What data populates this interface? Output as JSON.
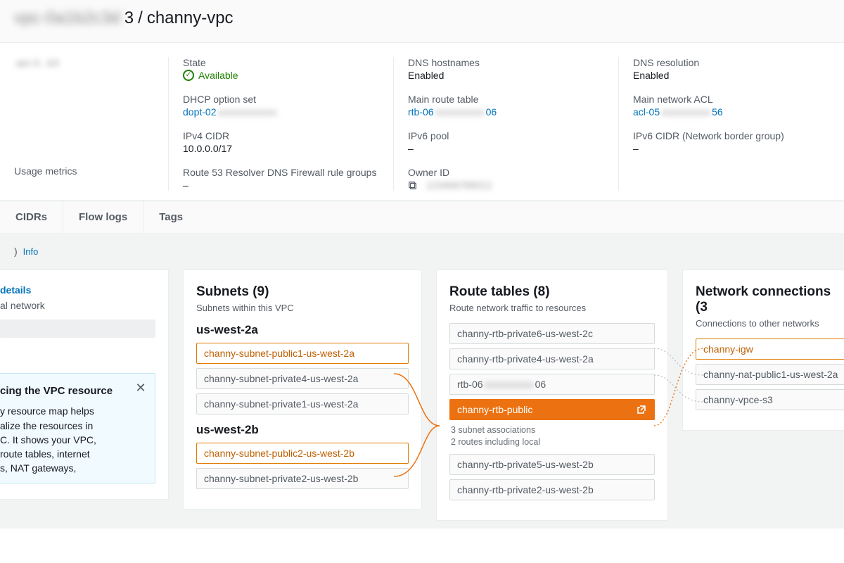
{
  "breadcrumb": {
    "prefix_blur": "vpc-0a1b2c3d",
    "sep": "/",
    "vpc_id_tail": "3",
    "vpc_name": "channy-vpc"
  },
  "details": {
    "col1": {
      "id_blur": "vpc-0...b3",
      "usage_metrics_label": "Usage metrics"
    },
    "col2": {
      "state_label": "State",
      "state_value": "Available",
      "dhcp_label": "DHCP option set",
      "dhcp_prefix": "dopt-02",
      "dhcp_blur": "xxxxxxxxxxxx",
      "ipv4_label": "IPv4 CIDR",
      "ipv4_value": "10.0.0.0/17",
      "r53_label": "Route 53 Resolver DNS Firewall rule groups",
      "dash": "–"
    },
    "col3": {
      "dns_host_label": "DNS hostnames",
      "dns_host_value": "Enabled",
      "main_rt_label": "Main route table",
      "main_rt_prefix": "rtb-06",
      "main_rt_blur": "xxxxxxxxxx",
      "main_rt_suffix": "06",
      "ipv6_pool_label": "IPv6 pool",
      "owner_label": "Owner ID",
      "owner_blur": "123456789012",
      "dash": "–"
    },
    "col4": {
      "dns_res_label": "DNS resolution",
      "dns_res_value": "Enabled",
      "acl_label": "Main network ACL",
      "acl_prefix": "acl-05",
      "acl_blur": "xxxxxxxxxx",
      "acl_suffix": "56",
      "ipv6_cidr_label": "IPv6 CIDR (Network border group)",
      "dash": "–"
    }
  },
  "tabs": {
    "cidrs": "CIDRs",
    "flowlogs": "Flow logs",
    "tags": "Tags"
  },
  "info_link": "Info",
  "vpc_card": {
    "details_link": "details",
    "sub": "al network",
    "pop_title": "cing the VPC resource",
    "pop_body": "y resource map helps\nalize the resources in\nC. It shows your VPC,\n route tables, internet\ns, NAT gateways,"
  },
  "subnets": {
    "title": "Subnets (9)",
    "sub": "Subnets within this VPC",
    "az1": "us-west-2a",
    "az1_items": [
      {
        "label": "channy-subnet-public1-us-west-2a",
        "hl": true
      },
      {
        "label": "channy-subnet-private4-us-west-2a",
        "hl": false
      },
      {
        "label": "channy-subnet-private1-us-west-2a",
        "hl": false
      }
    ],
    "az2": "us-west-2b",
    "az2_items": [
      {
        "label": "channy-subnet-public2-us-west-2b",
        "hl": true
      },
      {
        "label": "channy-subnet-private2-us-west-2b",
        "hl": false
      }
    ]
  },
  "route_tables": {
    "title": "Route tables (8)",
    "sub": "Route network traffic to resources",
    "items": [
      {
        "label": "channy-rtb-private6-us-west-2c",
        "state": ""
      },
      {
        "label": "channy-rtb-private4-us-west-2a",
        "state": ""
      },
      {
        "label": "rtb-06xxxxxxxxxx06",
        "state": "blur"
      },
      {
        "label": "channy-rtb-public",
        "state": "selected"
      },
      {
        "label": "channy-rtb-private5-us-west-2b",
        "state": ""
      },
      {
        "label": "channy-rtb-private2-us-west-2b",
        "state": ""
      }
    ],
    "selected_meta1": "3 subnet associations",
    "selected_meta2": "2 routes including local"
  },
  "net_conn": {
    "title": "Network connections (3",
    "sub": "Connections to other networks",
    "items": [
      {
        "label": "channy-igw",
        "hl": true
      },
      {
        "label": "channy-nat-public1-us-west-2a",
        "hl": false
      },
      {
        "label": "channy-vpce-s3",
        "hl": false
      }
    ]
  }
}
